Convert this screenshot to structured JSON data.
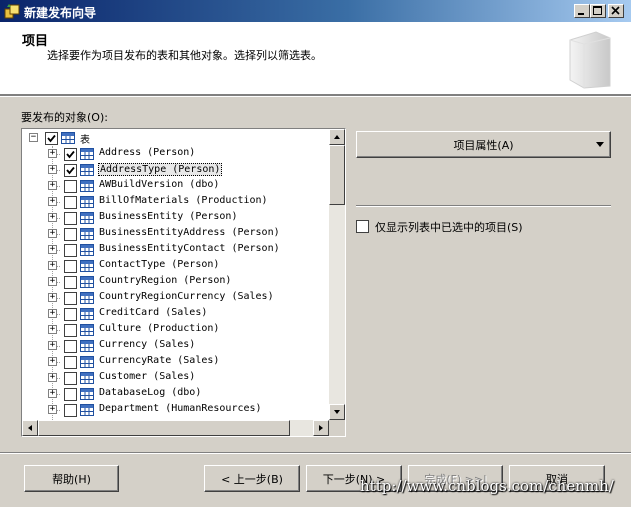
{
  "window": {
    "title": "新建发布向导"
  },
  "header": {
    "title": "项目",
    "subtitle": "选择要作为项目发布的表和其他对象。选择列以筛选表。"
  },
  "objects_label": "要发布的对象(O):",
  "tree": {
    "root": {
      "label": "表",
      "checked": true,
      "expanded": true
    },
    "items": [
      {
        "label": "Address (Person)",
        "checked": true,
        "selected": false
      },
      {
        "label": "AddressType (Person)",
        "checked": true,
        "selected": true
      },
      {
        "label": "AWBuildVersion (dbo)",
        "checked": false,
        "selected": false
      },
      {
        "label": "BillOfMaterials (Production)",
        "checked": false,
        "selected": false
      },
      {
        "label": "BusinessEntity (Person)",
        "checked": false,
        "selected": false
      },
      {
        "label": "BusinessEntityAddress (Person)",
        "checked": false,
        "selected": false
      },
      {
        "label": "BusinessEntityContact (Person)",
        "checked": false,
        "selected": false
      },
      {
        "label": "ContactType (Person)",
        "checked": false,
        "selected": false
      },
      {
        "label": "CountryRegion (Person)",
        "checked": false,
        "selected": false
      },
      {
        "label": "CountryRegionCurrency (Sales)",
        "checked": false,
        "selected": false
      },
      {
        "label": "CreditCard (Sales)",
        "checked": false,
        "selected": false
      },
      {
        "label": "Culture (Production)",
        "checked": false,
        "selected": false
      },
      {
        "label": "Currency (Sales)",
        "checked": false,
        "selected": false
      },
      {
        "label": "CurrencyRate (Sales)",
        "checked": false,
        "selected": false
      },
      {
        "label": "Customer (Sales)",
        "checked": false,
        "selected": false
      },
      {
        "label": "DatabaseLog (dbo)",
        "checked": false,
        "selected": false
      },
      {
        "label": "Department (HumanResources)",
        "checked": false,
        "selected": false
      }
    ]
  },
  "item_properties_label": "项目属性(A)",
  "show_only_checked_label": "仅显示列表中已选中的项目(S)",
  "buttons": {
    "help": "帮助(H)",
    "back": "< 上一步(B)",
    "next": "下一步(N) >",
    "finish": "完成(F) >>|",
    "cancel": "取消"
  },
  "watermark": "http://www.cnblogs.com/chenmh/"
}
